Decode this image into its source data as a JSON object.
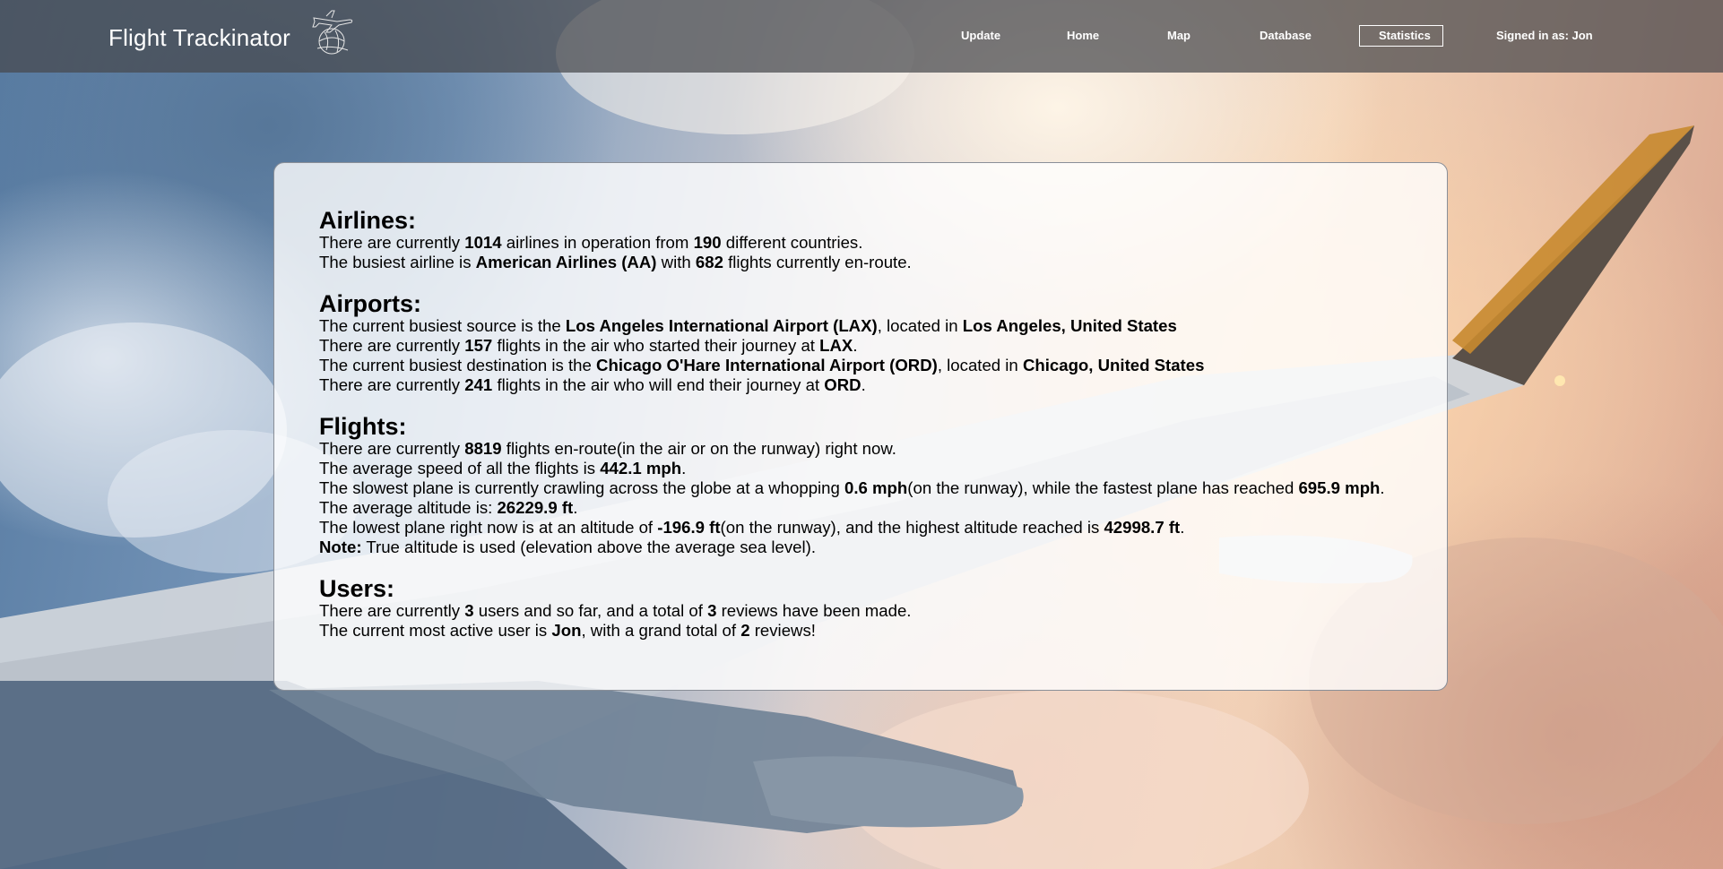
{
  "header": {
    "brand": "Flight Trackinator",
    "nav": [
      {
        "label": "Update"
      },
      {
        "label": "Home"
      },
      {
        "label": "Map"
      },
      {
        "label": "Database"
      },
      {
        "label": "Statistics",
        "active": true
      }
    ],
    "signed_in": "Signed in as: Jon"
  },
  "airlines": {
    "heading": "Airlines:",
    "l1_a": "There are currently ",
    "l1_count": "1014",
    "l1_b": " airlines in operation from ",
    "l1_countries": "190",
    "l1_c": " different countries.",
    "l2_a": "The busiest airline is ",
    "l2_airline": "American Airlines (AA)",
    "l2_b": " with ",
    "l2_flights": "682",
    "l2_c": " flights currently en-route."
  },
  "airports": {
    "heading": "Airports:",
    "l1_a": "The current busiest source is the ",
    "l1_airport": "Los Angeles International Airport (LAX)",
    "l1_b": ", located in ",
    "l1_city": "Los Angeles, United States",
    "l2_a": "There are currently ",
    "l2_count": "157",
    "l2_b": " flights in the air who started their journey at ",
    "l2_code": "LAX",
    "l2_c": ".",
    "l3_a": "The current busiest destination is the ",
    "l3_airport": "Chicago O'Hare International Airport (ORD)",
    "l3_b": ", located in ",
    "l3_city": "Chicago, United States",
    "l4_a": "There are currently ",
    "l4_count": "241",
    "l4_b": " flights in the air who will end their journey at ",
    "l4_code": "ORD",
    "l4_c": "."
  },
  "flights": {
    "heading": "Flights:",
    "l1_a": "There are currently ",
    "l1_count": "8819",
    "l1_b": " flights en-route(in the air or on the runway) right now.",
    "l2_a": "The average speed of all the flights is ",
    "l2_speed": "442.1 mph",
    "l2_b": ".",
    "l3_a": "The slowest plane is currently crawling across the globe at a whopping ",
    "l3_slow": "0.6 mph",
    "l3_b": "(on the runway), while the fastest plane has reached ",
    "l3_fast": "695.9 mph",
    "l3_c": ".",
    "l4_a": "The average altitude is: ",
    "l4_alt": "26229.9 ft",
    "l4_b": ".",
    "l5_a": "The lowest plane right now is at an altitude of ",
    "l5_low": "-196.9 ft",
    "l5_b": "(on the runway), and the highest altitude reached is ",
    "l5_high": "42998.7 ft",
    "l5_c": ".",
    "l6_note": "Note:",
    "l6_text": " True altitude is used (elevation above the average sea level)."
  },
  "users": {
    "heading": "Users:",
    "l1_a": "There are currently ",
    "l1_users": "3",
    "l1_b": " users and so far, and a total of ",
    "l1_reviews": "3",
    "l1_c": " reviews have been made.",
    "l2_a": "The current most active user is ",
    "l2_user": "Jon",
    "l2_b": ", with a grand total of ",
    "l2_count": "2",
    "l2_c": " reviews!"
  }
}
